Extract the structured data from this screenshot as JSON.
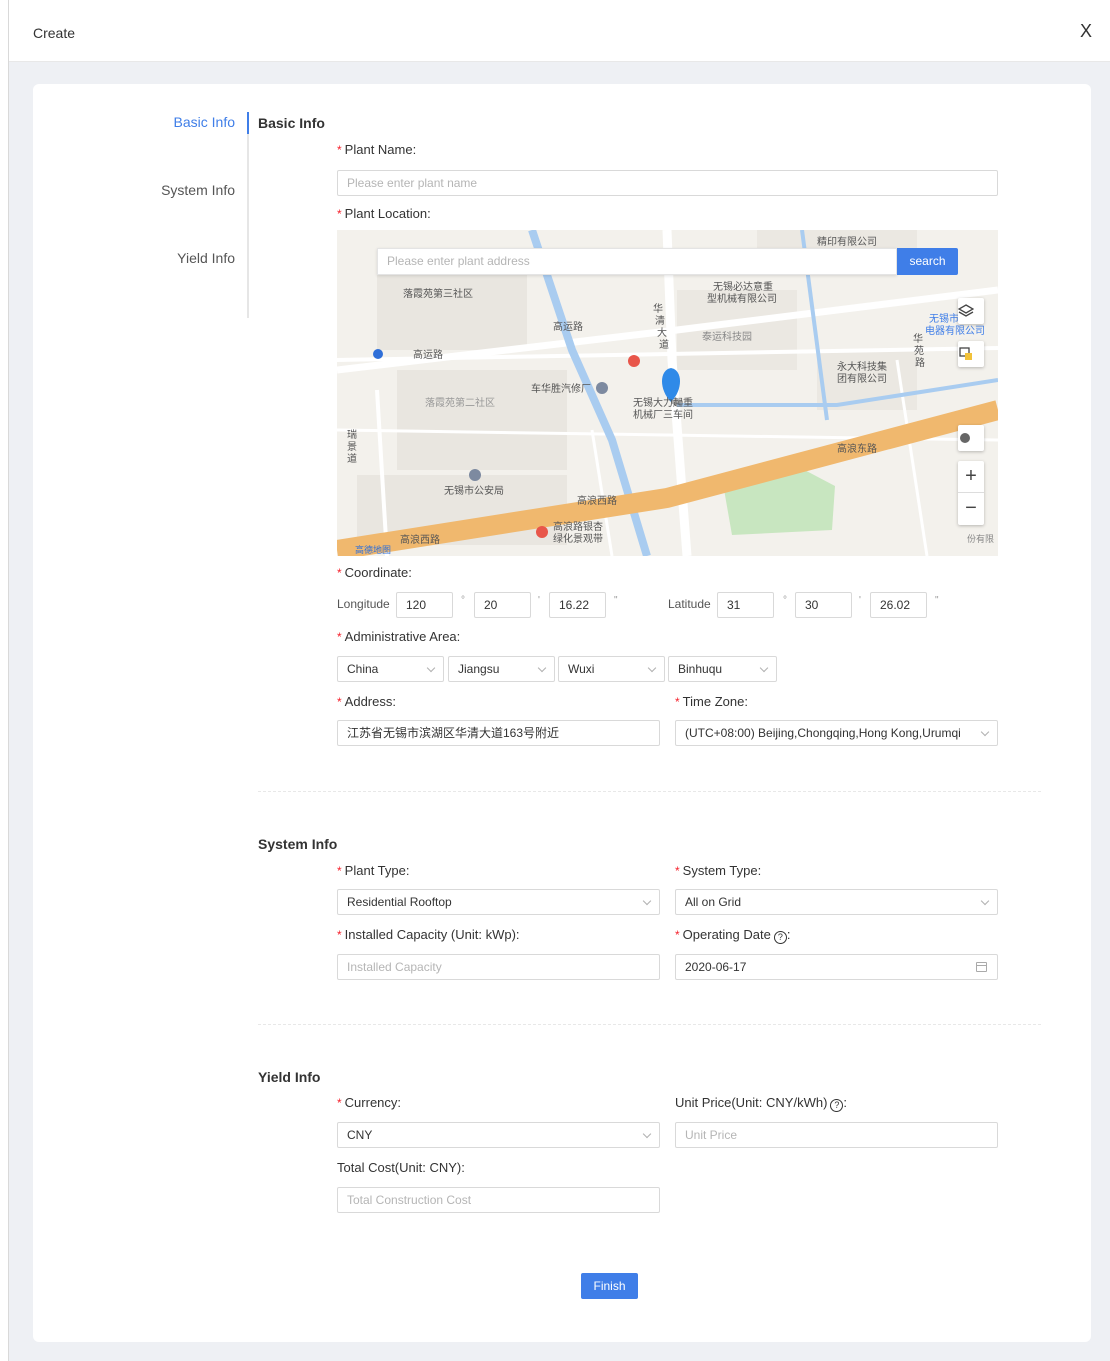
{
  "header": {
    "title": "Create",
    "close": "X"
  },
  "anchor": {
    "items": [
      "Basic Info",
      "System Info",
      "Yield Info"
    ]
  },
  "basic": {
    "title": "Basic Info",
    "plant_name_label": "Plant Name",
    "plant_name_placeholder": "Please enter plant name",
    "location_label": "Plant Location",
    "coordinate_label": "Coordinate",
    "longitude_label": "Longitude",
    "longitude": [
      "120",
      "20",
      "16.22"
    ],
    "latitude_label": "Latitude",
    "latitude": [
      "31",
      "30",
      "26.02"
    ],
    "deg_marks": [
      "°",
      "'",
      "\""
    ],
    "admin_label": "Administrative Area",
    "admin": [
      "China",
      "Jiangsu",
      "Wuxi",
      "Binhuqu"
    ],
    "address_label": "Address",
    "address": "江苏省无锡市滨湖区华清大道163号附近",
    "timezone_label": "Time Zone",
    "timezone": "(UTC+08:00) Beijing,Chongqing,Hong Kong,Urumqi"
  },
  "map": {
    "search_placeholder": "Please enter plant address",
    "search_button": "search",
    "labels": [
      "落霞苑第三社区",
      "高运路",
      "高运路",
      "落霞苑第二社区",
      "车华胜汽修厂",
      "无锡市公安局",
      "高浪西路",
      "高浪西路",
      "高浪路银杏",
      "绿化景观带",
      "高浪东路",
      "华",
      "清",
      "大",
      "道",
      "泰运科技园",
      "无锡必达意重",
      "型机械有限公司",
      "无锡市",
      "电器有限公司",
      "华",
      "苑",
      "路",
      "永大科技集",
      "团有限公司",
      "无锡大力起重",
      "机械厂三车间",
      "瑞",
      "景",
      "道",
      "精印有限公司",
      "高德地图",
      "份有限"
    ]
  },
  "system": {
    "title": "System Info",
    "plant_type_label": "Plant Type",
    "plant_type": "Residential Rooftop",
    "system_type_label": "System Type",
    "system_type": "All on Grid",
    "capacity_label": "Installed Capacity (Unit: kWp)",
    "capacity_placeholder": "Installed Capacity",
    "date_label": "Operating Date",
    "date": "2020-06-17"
  },
  "yield": {
    "title": "Yield Info",
    "currency_label": "Currency",
    "currency": "CNY",
    "unit_price_label": "Unit Price(Unit: CNY/kWh)",
    "unit_price_placeholder": "Unit Price",
    "total_cost_label": "Total Cost(Unit: CNY)",
    "total_cost_placeholder": "Total Construction Cost"
  },
  "finish_label": "Finish",
  "colors": {
    "primary": "#3f7ee8",
    "required": "#f5222d",
    "road_major": "#f0b86e",
    "water": "#a9ccf0",
    "park": "#c8e6c0"
  }
}
